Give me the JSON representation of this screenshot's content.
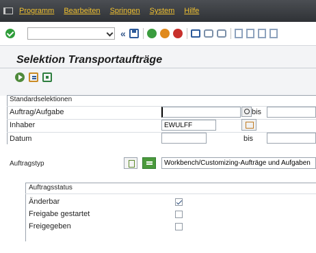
{
  "menubar": {
    "items": [
      {
        "label": "Programm"
      },
      {
        "label": "Bearbeiten"
      },
      {
        "label": "Springen"
      },
      {
        "label": "System"
      },
      {
        "label": "Hilfe"
      }
    ]
  },
  "toolbar": {
    "command_value": ""
  },
  "page": {
    "title": "Selektion Transportaufträge"
  },
  "standard_selections": {
    "title": "Standardselektionen",
    "auftrag_label": "Auftrag/Aufgabe",
    "auftrag_value": "",
    "bis_label_1": "bis",
    "inhaber_label": "Inhaber",
    "inhaber_value": "EWULFF",
    "datum_label": "Datum",
    "datum_value": "",
    "bis_label_2": "bis"
  },
  "auftragstyp": {
    "label": "Auftragstyp",
    "value": "Workbench/Customizing-Aufträge und Aufgaben"
  },
  "auftragsstatus": {
    "title": "Auftragsstatus",
    "items": [
      {
        "label": "Änderbar",
        "checked": true
      },
      {
        "label": "Freigabe gestartet",
        "checked": false
      },
      {
        "label": "Freigegeben",
        "checked": false
      }
    ]
  },
  "colors": {
    "menubar_bg": "#3a3d42",
    "menu_text": "#f2c230",
    "title_area_bg": "#f3f4f6"
  }
}
